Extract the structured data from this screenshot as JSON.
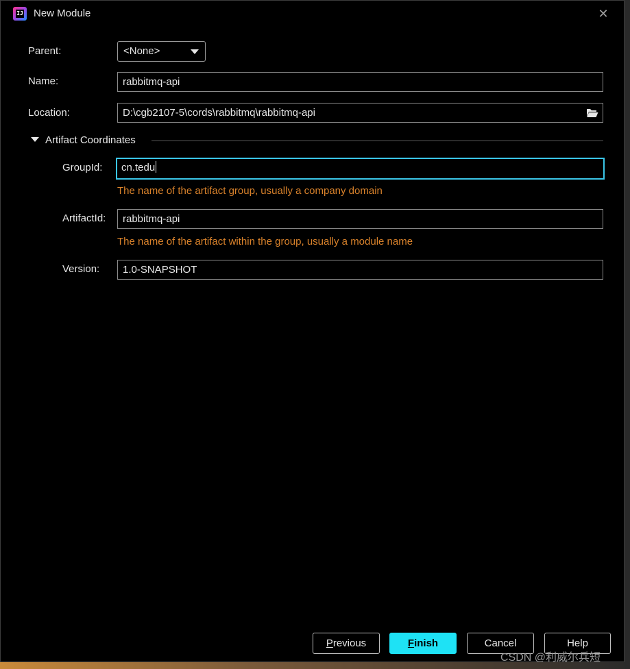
{
  "window": {
    "title": "New Module",
    "app_icon": "IJ"
  },
  "form": {
    "parent": {
      "label": "Parent:",
      "value": "<None>"
    },
    "name": {
      "label": "Name:",
      "value": "rabbitmq-api"
    },
    "location": {
      "label": "Location:",
      "value": "D:\\cgb2107-5\\cords\\rabbitmq\\rabbitmq-api"
    }
  },
  "artifact": {
    "section_title": "Artifact Coordinates",
    "group_id": {
      "label": "GroupId:",
      "value": "cn.tedu",
      "hint": "The name of the artifact group, usually a company domain"
    },
    "artifact_id": {
      "label": "ArtifactId:",
      "value": "rabbitmq-api",
      "hint": "The name of the artifact within the group, usually a module name"
    },
    "version": {
      "label": "Version:",
      "value": "1.0-SNAPSHOT"
    }
  },
  "buttons": {
    "previous": {
      "mnemonic": "P",
      "rest": "revious"
    },
    "finish": {
      "mnemonic": "F",
      "rest": "inish"
    },
    "cancel": "Cancel",
    "help": "Help"
  },
  "watermark": "CSDN @利威尔兵短",
  "colors": {
    "accent": "#1ee2f5",
    "focus_border": "#3ac6e8",
    "hint": "#d9822b",
    "background": "#000000"
  }
}
